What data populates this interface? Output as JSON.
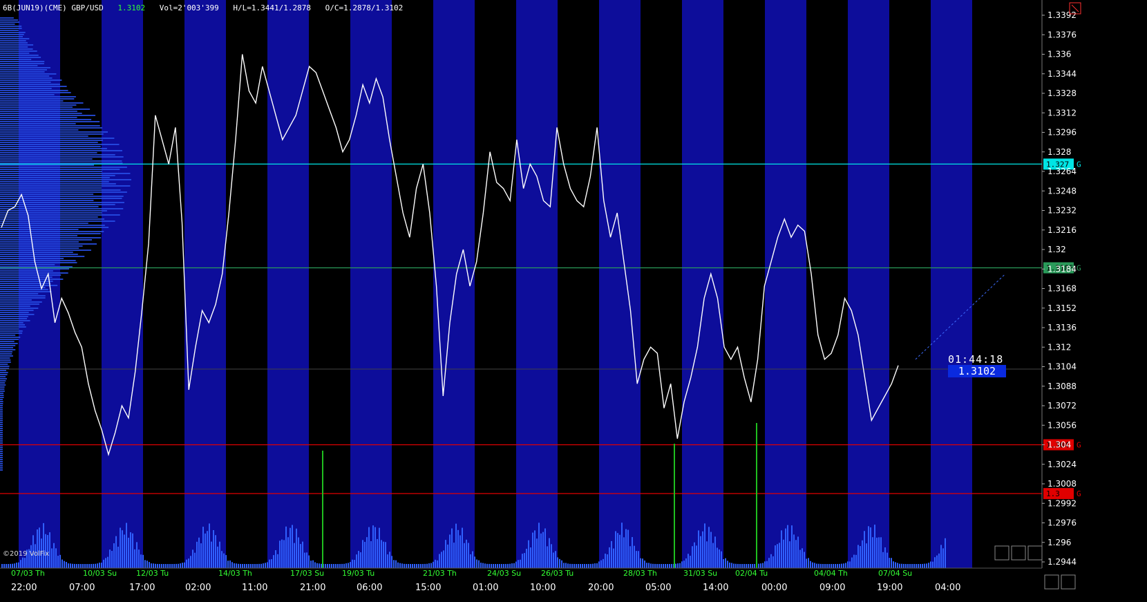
{
  "header": {
    "symbol": "6B(JUN19)(CME) GBP/USD",
    "last": "1.3102",
    "volume": "Vol=2'003'399",
    "high_low": "H/L=1.3441/1.2878",
    "open_close": "O/C=1.2878/1.3102"
  },
  "copyright": "©2019 VolFix",
  "timer": "01:44:18",
  "current_price": "1.3102",
  "price_axis": {
    "min": 1.2944,
    "max": 1.3392,
    "ticks": [
      "1.3392",
      "1.3376",
      "1.336",
      "1.3344",
      "1.3328",
      "1.3312",
      "1.3296",
      "1.328",
      "1.3264",
      "1.3248",
      "1.3232",
      "1.3216",
      "1.32",
      "1.3184",
      "1.3168",
      "1.3152",
      "1.3136",
      "1.312",
      "1.3104",
      "1.3088",
      "1.3072",
      "1.3056",
      "1.304",
      "1.3024",
      "1.3008",
      "1.2992",
      "1.2976",
      "1.296",
      "1.2944"
    ]
  },
  "levels": [
    {
      "price": 1.327,
      "label": "1.327",
      "color": "#00e5e5",
      "suffix": "G"
    },
    {
      "price": 1.3185,
      "label": "1.3185",
      "color": "#2a9a5a",
      "suffix": "G"
    },
    {
      "price": 1.304,
      "label": "1.304",
      "color": "#e00000",
      "suffix": "G"
    },
    {
      "price": 1.3,
      "label": "1.3",
      "color": "#e00000",
      "suffix": "G"
    }
  ],
  "date_labels": [
    "07/03 Th",
    "10/03 Su",
    "12/03 Tu",
    "14/03 Th",
    "17/03 Su",
    "19/03 Tu",
    "21/03 Th",
    "24/03 Su",
    "26/03 Tu",
    "28/03 Th",
    "31/03 Su",
    "02/04 Tu",
    "04/04 Th",
    "07/04 Su"
  ],
  "time_labels": [
    "22:00",
    "07:00",
    "17:00",
    "02:00",
    "11:00",
    "21:00",
    "06:00",
    "15:00",
    "01:00",
    "10:00",
    "20:00",
    "05:00",
    "14:00",
    "00:00",
    "09:00",
    "19:00",
    "04:00"
  ],
  "colors": {
    "band_blue": "#0d0d9a",
    "band_black": "#000000",
    "price_line": "#ffffff",
    "volume": "#3060ff",
    "volume_spike": "#1fbf1f",
    "profile": "#2850e8",
    "axis_text": "#ffffff",
    "date_text": "#33ff33"
  },
  "chart_data": {
    "type": "line",
    "title": "6B(JUN19)(CME) GBP/USD",
    "ylim": [
      1.2944,
      1.3392
    ],
    "series": [
      {
        "name": "price",
        "values": [
          1.3218,
          1.3232,
          1.3235,
          1.3245,
          1.3228,
          1.319,
          1.3168,
          1.318,
          1.314,
          1.316,
          1.3148,
          1.3132,
          1.312,
          1.309,
          1.3068,
          1.3052,
          1.3032,
          1.305,
          1.3072,
          1.3062,
          1.31,
          1.315,
          1.3205,
          1.331,
          1.329,
          1.327,
          1.33,
          1.3222,
          1.3085,
          1.312,
          1.315,
          1.314,
          1.3155,
          1.318,
          1.323,
          1.329,
          1.336,
          1.333,
          1.332,
          1.335,
          1.333,
          1.331,
          1.329,
          1.33,
          1.331,
          1.333,
          1.335,
          1.3345,
          1.333,
          1.3315,
          1.33,
          1.328,
          1.329,
          1.331,
          1.3335,
          1.332,
          1.334,
          1.3325,
          1.329,
          1.326,
          1.323,
          1.321,
          1.325,
          1.327,
          1.323,
          1.317,
          1.308,
          1.314,
          1.318,
          1.32,
          1.317,
          1.319,
          1.323,
          1.328,
          1.3255,
          1.325,
          1.324,
          1.329,
          1.325,
          1.327,
          1.326,
          1.324,
          1.3235,
          1.33,
          1.327,
          1.325,
          1.324,
          1.3235,
          1.326,
          1.33,
          1.324,
          1.321,
          1.323,
          1.319,
          1.315,
          1.309,
          1.311,
          1.312,
          1.3115,
          1.307,
          1.309,
          1.3045,
          1.3075,
          1.3095,
          1.312,
          1.316,
          1.318,
          1.316,
          1.312,
          1.311,
          1.312,
          1.3095,
          1.3075,
          1.311,
          1.317,
          1.319,
          1.321,
          1.3225,
          1.321,
          1.322,
          1.3215,
          1.318,
          1.313,
          1.311,
          1.3115,
          1.313,
          1.316,
          1.315,
          1.313,
          1.3095,
          1.306,
          1.307,
          1.308,
          1.309,
          1.3105
        ]
      }
    ]
  }
}
